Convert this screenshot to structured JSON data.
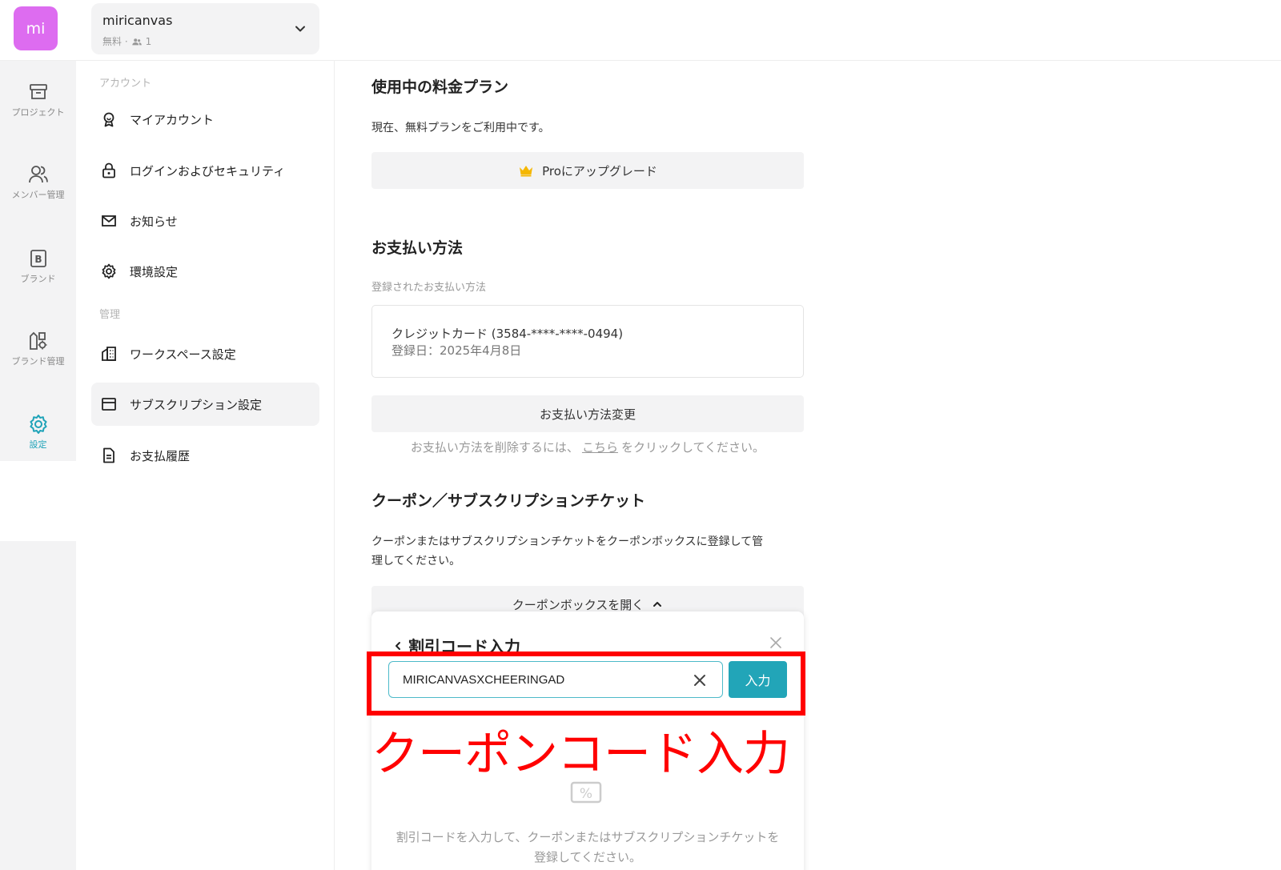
{
  "app": {
    "logo_text": "mi",
    "workspace_name": "miricanvas",
    "workspace_plan": "無料 ·",
    "workspace_members": "1"
  },
  "rail": [
    {
      "label": "プロジェクト",
      "icon": "archive-box-icon"
    },
    {
      "label": "メンバー管理",
      "icon": "users-icon"
    },
    {
      "label": "ブランド",
      "icon": "brand-b-icon"
    },
    {
      "label": "ブランド管理",
      "icon": "brand-manage-icon"
    },
    {
      "label": "設定",
      "icon": "gear-icon",
      "active": true
    }
  ],
  "menu": {
    "section_account": "アカウント",
    "section_admin": "管理",
    "items": [
      {
        "label": "マイアカウント",
        "icon": "account-badge-icon"
      },
      {
        "label": "ログインおよびセキュリティ",
        "icon": "lock-icon"
      },
      {
        "label": "お知らせ",
        "icon": "mail-icon"
      },
      {
        "label": "環境設定",
        "icon": "gear-icon"
      },
      {
        "label": "ワークスペース設定",
        "icon": "building-icon"
      },
      {
        "label": "サブスクリプション設定",
        "icon": "card-icon",
        "active": true
      },
      {
        "label": "お支払履歴",
        "icon": "document-icon"
      }
    ]
  },
  "plan": {
    "heading": "使用中の料金プラン",
    "current": "現在、無料プランをご利用中です。",
    "upgrade_label": "Proにアップグレード"
  },
  "payment": {
    "heading": "お支払い方法",
    "registered_label": "登録されたお支払い方法",
    "card_line": "クレジットカード (3584-****-****-0494)",
    "registered_date": "登録日：2025年4月8日",
    "change_label": "お支払い方法変更",
    "remove_prefix": "お支払い方法を削除するには、",
    "remove_link": "こちら",
    "remove_suffix": "をクリックしてください。"
  },
  "coupon": {
    "heading": "クーポン／サブスクリプションチケット",
    "description_line1": "クーポンまたはサブスクリプションチケットをクーポンボックスに登録して管",
    "description_line2": "理してください。",
    "open_box_label": "クーポンボックスを開く",
    "popup_title": "割引コード入力",
    "code_value": "MIRICANVASXCHEERINGAD",
    "submit_label": "入力",
    "annotation": "クーポンコード入力",
    "percent_glyph": "%",
    "hint_line1": "割引コードを入力して、クーポンまたはサブスクリプションチケットを",
    "hint_line2": "登録してください。"
  },
  "colors": {
    "logo_bg": "#dd6cf0",
    "accent": "#22a5b8",
    "annotation_red": "#ff0000",
    "crown": "#f5b700"
  }
}
